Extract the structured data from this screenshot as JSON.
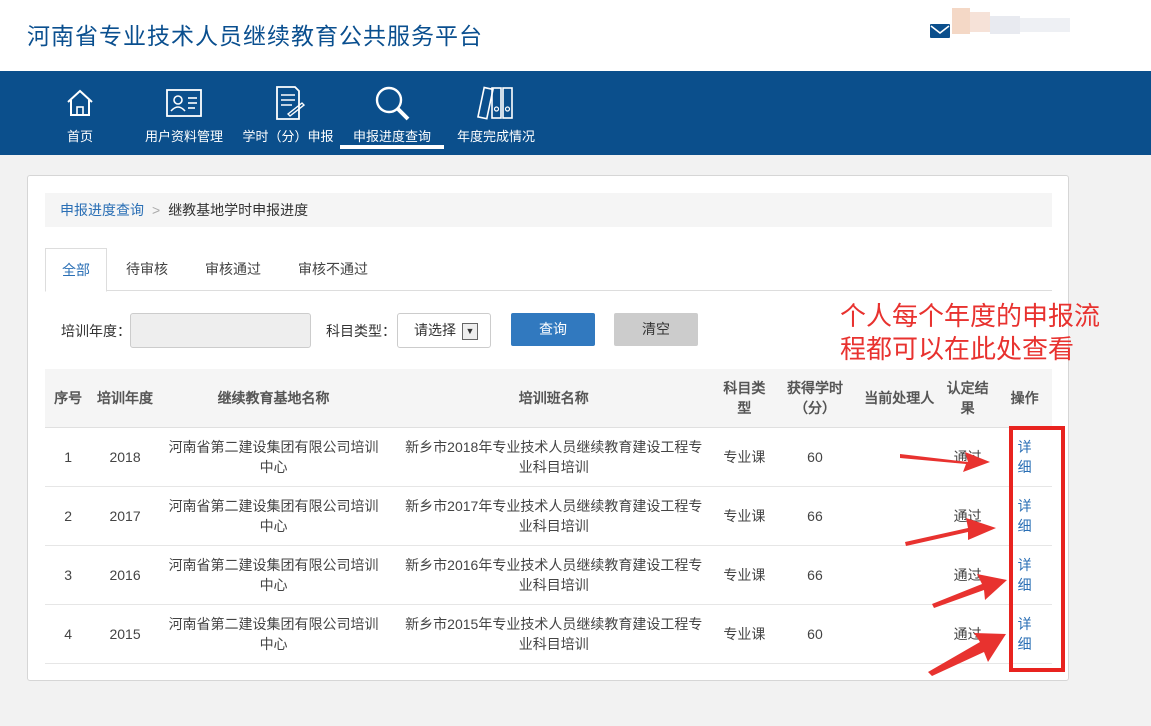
{
  "header": {
    "site_title": "河南省专业技术人员继续教育公共服务平台"
  },
  "nav": {
    "items": [
      {
        "label": "首页",
        "icon": "home-icon"
      },
      {
        "label": "用户资料管理",
        "icon": "user-card-icon"
      },
      {
        "label": "学时（分）申报",
        "icon": "document-edit-icon"
      },
      {
        "label": "申报进度查询",
        "icon": "search-icon",
        "active": true
      },
      {
        "label": "年度完成情况",
        "icon": "binders-icon"
      }
    ]
  },
  "breadcrumb": {
    "link": "申报进度查询",
    "separator": ">",
    "current": "继教基地学时申报进度"
  },
  "tabs": [
    {
      "label": "全部",
      "active": true
    },
    {
      "label": "待审核"
    },
    {
      "label": "审核通过"
    },
    {
      "label": "审核不通过"
    }
  ],
  "filter": {
    "year_label": "培训年度：",
    "year_value": "",
    "subject_label": "科目类型：",
    "subject_selected": "请选择",
    "query_button": "查询",
    "clear_button": "清空"
  },
  "table": {
    "headers": [
      "序号",
      "培训年度",
      "继续教育基地名称",
      "培训班名称",
      "科目类型",
      "获得学时（分）",
      "当前处理人",
      "认定结果",
      "操作"
    ],
    "rows": [
      {
        "no": "1",
        "year": "2018",
        "base": "河南省第二建设集团有限公司培训中心",
        "class": "新乡市2018年专业技术人员继续教育建设工程专业科目培训",
        "type": "专业课",
        "hours": "60",
        "handler": "",
        "result": "通过",
        "action": "详细"
      },
      {
        "no": "2",
        "year": "2017",
        "base": "河南省第二建设集团有限公司培训中心",
        "class": "新乡市2017年专业技术人员继续教育建设工程专业科目培训",
        "type": "专业课",
        "hours": "66",
        "handler": "",
        "result": "通过",
        "action": "详细"
      },
      {
        "no": "3",
        "year": "2016",
        "base": "河南省第二建设集团有限公司培训中心",
        "class": "新乡市2016年专业技术人员继续教育建设工程专业科目培训",
        "type": "专业课",
        "hours": "66",
        "handler": "",
        "result": "通过",
        "action": "详细"
      },
      {
        "no": "4",
        "year": "2015",
        "base": "河南省第二建设集团有限公司培训中心",
        "class": "新乡市2015年专业技术人员继续教育建设工程专业科目培训",
        "type": "专业课",
        "hours": "60",
        "handler": "",
        "result": "通过",
        "action": "详细"
      }
    ]
  },
  "annotation": {
    "line1": "个人每个年度的申报流",
    "line2": "程都可以在此处查看"
  },
  "colors": {
    "nav_bg": "#0b4f8c",
    "title": "#0a4f8f",
    "link": "#2a6fb5",
    "annotation": "#e8322f"
  }
}
